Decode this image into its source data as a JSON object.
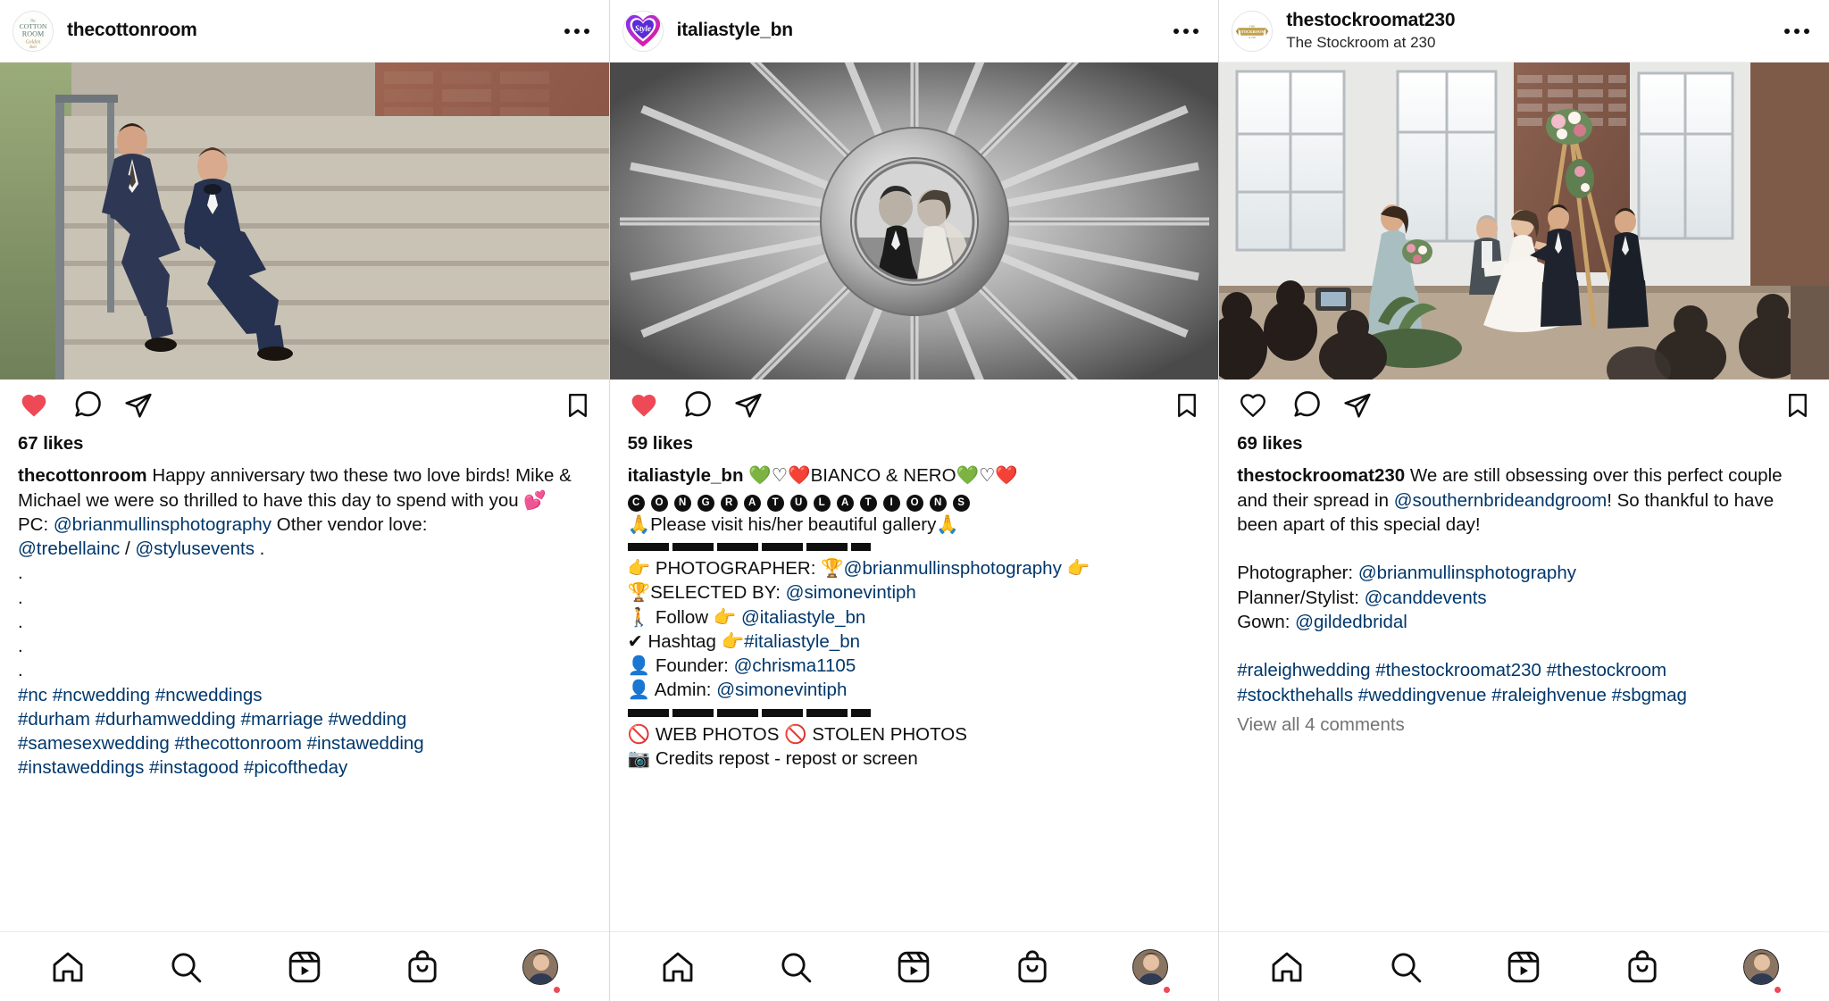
{
  "app": {
    "name": "Instagram",
    "columns_count": 3
  },
  "posts": [
    {
      "username": "thecottonroom",
      "subtitle": "",
      "avatar_icon": "cotton-room-logo",
      "more_icon": "more-options-icon",
      "liked": true,
      "like_icon": "heart-filled-icon",
      "comment_icon": "comment-icon",
      "share_icon": "share-icon",
      "save_icon": "bookmark-icon",
      "likes": "67 likes",
      "caption_author": "thecottonroom",
      "caption_text": " Happy anniversary two these two love birds! Mike & Michael we were so thrilled to have this day to spend with you ",
      "caption_emoji": "💕",
      "credit_prefix": "PC: ",
      "credit_mention": "@brianmullinsphotography",
      "credit_mid": " Other vendor love:",
      "vendor_1": "@trebellainc",
      "vendor_sep": " / ",
      "vendor_2": "@stylusevents",
      "vendor_end": " .",
      "dots": [
        ".",
        ".",
        ".",
        ".",
        "."
      ],
      "hashtag_lines": [
        "#nc #ncwedding #ncweddings",
        "#durham #durhamwedding #marriage #wedding",
        "#samesexwedding #thecottonroom #instawedding",
        "#instaweddings #instagood #picoftheday"
      ],
      "view_comments": ""
    },
    {
      "username": "italiastyle_bn",
      "subtitle": "",
      "avatar_icon": "italia-style-heart-logo",
      "more_icon": "more-options-icon",
      "liked": true,
      "like_icon": "heart-filled-icon",
      "comment_icon": "comment-icon",
      "share_icon": "share-icon",
      "save_icon": "bookmark-icon",
      "likes": "59 likes",
      "caption_author": "italiastyle_bn",
      "title_emojis_left": "💚♡❤️",
      "title_text": "BIANCO & NERO",
      "title_emojis_right": "💚♡❤️",
      "congrats_letters": [
        "C",
        "O",
        "N",
        "G",
        "R",
        "A",
        "T",
        "U",
        "L",
        "A",
        "T",
        "I",
        "O",
        "N",
        "S"
      ],
      "gallery_line_emoji_left": "🙏",
      "gallery_line": "Please visit his/her beautiful gallery",
      "gallery_line_emoji_right": "🙏",
      "rows": [
        {
          "emoji": "👉",
          "label": "PHOTOGRAPHER: ",
          "emoji2": "🏆",
          "mention": "@brianmullinsphotography",
          "emoji3": "👉"
        },
        {
          "emoji": "🏆",
          "label": "SELECTED BY: ",
          "mention": "@simonevintiph"
        },
        {
          "emoji": "🚶",
          "label": "Follow ",
          "emoji2": "👉",
          "mention": "@italiastyle_bn"
        },
        {
          "emoji": "✔",
          "label": "Hashtag ",
          "emoji2": "👉",
          "mention": "#italiastyle_bn"
        },
        {
          "emoji": "👤",
          "label": "Founder: ",
          "mention": "@chrisma1105"
        },
        {
          "emoji": "👤",
          "label": "Admin: ",
          "mention": "@simonevintiph"
        }
      ],
      "warn_emoji": "🚫",
      "warn_text_1": "WEB PHOTOS",
      "warn_text_2": "STOLEN PHOTOS",
      "cut_line_emoji": "📷",
      "cut_line_text": "Credits repost - repost or screen"
    },
    {
      "username": "thestockroomat230",
      "subtitle": "The Stockroom at 230",
      "avatar_icon": "stockroom-logo",
      "more_icon": "more-options-icon",
      "liked": false,
      "like_icon": "heart-outline-icon",
      "comment_icon": "comment-icon",
      "share_icon": "share-icon",
      "save_icon": "bookmark-icon",
      "likes": "69 likes",
      "caption_author": "thestockroomat230",
      "caption_text_1": " We are still obsessing over this perfect couple and their spread in ",
      "caption_mention": "@southernbrideandgroom",
      "caption_text_2": "! So thankful to have been apart of this special day!",
      "credits": [
        {
          "label": "Photographer: ",
          "mention": "@brianmullinsphotography"
        },
        {
          "label": "Planner/Stylist: ",
          "mention": "@canddevents"
        },
        {
          "label": "Gown: ",
          "mention": "@gildedbridal"
        }
      ],
      "hashtag_lines": [
        "#raleighwedding #thestockroomat230 #thestockroom",
        "#stockthehalls #weddingvenue #raleighvenue #sbgmag"
      ],
      "view_comments": "View all 4 comments"
    }
  ],
  "bottom_nav": {
    "items": [
      {
        "icon": "home-icon",
        "label": "Home"
      },
      {
        "icon": "search-icon",
        "label": "Search"
      },
      {
        "icon": "reels-icon",
        "label": "Reels"
      },
      {
        "icon": "shop-icon",
        "label": "Shop"
      },
      {
        "icon": "profile-avatar-icon",
        "label": "Profile"
      }
    ],
    "active_index": 4,
    "notification_dot_color": "#ed4956"
  },
  "colors": {
    "like_red": "#ed4956",
    "link_blue": "#00376b",
    "text_primary": "#0f0f0f",
    "text_secondary": "#737373",
    "border": "#dbdbdb"
  }
}
